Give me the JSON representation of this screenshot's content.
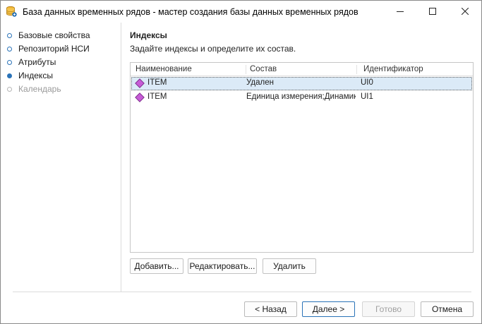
{
  "window": {
    "title": "База данных временных рядов - мастер создания базы данных временных рядов",
    "icon": "database-icon"
  },
  "nav": {
    "items": [
      {
        "label": "Базовые свойства",
        "state": "visited"
      },
      {
        "label": "Репозиторий НСИ",
        "state": "visited"
      },
      {
        "label": "Атрибуты",
        "state": "visited"
      },
      {
        "label": "Индексы",
        "state": "current"
      },
      {
        "label": "Календарь",
        "state": "disabled"
      }
    ]
  },
  "page": {
    "title": "Индексы",
    "subtitle": "Задайте индексы и определите их состав."
  },
  "grid": {
    "columns": [
      "Наименование",
      "Состав",
      "Идентификатор"
    ],
    "rows": [
      {
        "name": "ITEM",
        "composition": "Удален",
        "id": "UI0",
        "icon": "index-diamond-icon",
        "selected": true
      },
      {
        "name": "ITEM",
        "composition": "Единица измерения;Динамика",
        "id": "UI1",
        "icon": "index-diamond-icon",
        "selected": false
      }
    ]
  },
  "actions": {
    "add": "Добавить...",
    "edit": "Редактировать...",
    "delete": "Удалить"
  },
  "footer": {
    "back": "< Назад",
    "next": "Далее >",
    "finish": "Готово",
    "cancel": "Отмена"
  },
  "colors": {
    "accent": "#2a73b8",
    "selection": "#dbeaf7",
    "index_icon": "#c65cd6"
  }
}
